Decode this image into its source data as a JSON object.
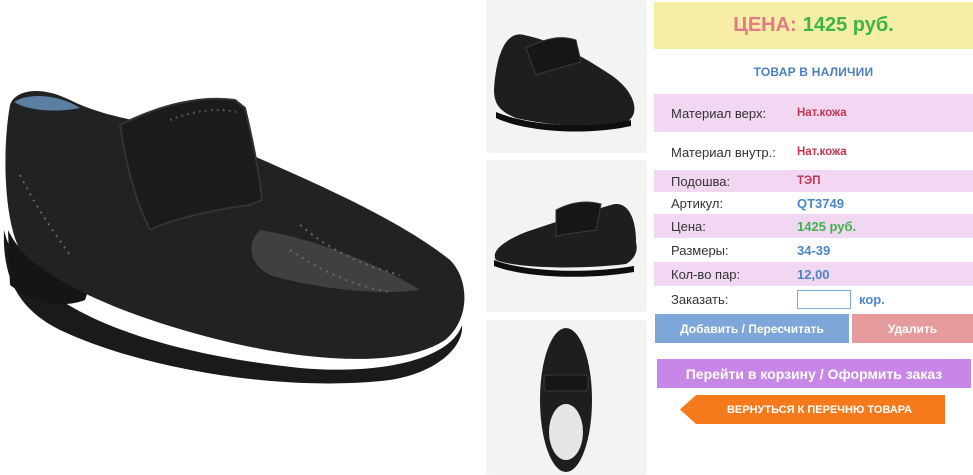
{
  "gallery": {
    "main_image": "black-leather-velcro-shoe-side-view",
    "thumbnails": [
      "shoe-side-view-right",
      "shoe-side-view-left",
      "shoe-top-view"
    ]
  },
  "price_header": {
    "label": "ЦЕНА:",
    "value": "1425 руб."
  },
  "stock_status": "ТОВАР В НАЛИЧИИ",
  "specs": [
    {
      "key": "Материал верх:",
      "value": "Нат.кожа"
    },
    {
      "key": "Материал внутр.:",
      "value": "Нат.кожа"
    },
    {
      "key": "Подошва:",
      "value": "ТЭП"
    },
    {
      "key": "Артикул:",
      "value": "QT3749"
    },
    {
      "key": "Цена:",
      "value": "1425 руб."
    },
    {
      "key": "Размеры:",
      "value": "34-39"
    },
    {
      "key": "Кол-во пар:",
      "value": "12,00"
    }
  ],
  "order": {
    "label": "Заказать:",
    "value": "",
    "unit": "кор."
  },
  "buttons": {
    "add": "Добавить / Пересчитать",
    "delete": "Удалить",
    "cart": "Перейти в корзину / Оформить заказ",
    "back": "ВЕРНУТЬСЯ К ПЕРЕЧНЮ ТОВАРА"
  },
  "colors": {
    "price_bg": "#f7eea6",
    "price_label": "#e07a86",
    "price_value": "#3cb44a",
    "row_pink": "#f2d7f2",
    "add_button": "#7fa6d8",
    "delete_button": "#e59b9b",
    "cart_button": "#c887e6",
    "back_button": "#f57a1c"
  }
}
